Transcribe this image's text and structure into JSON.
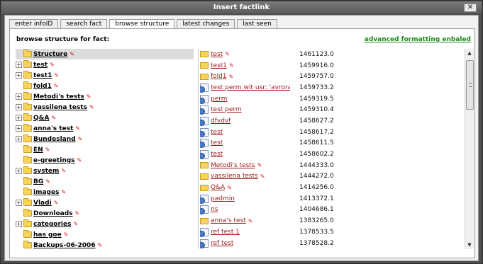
{
  "window": {
    "title": "Insert factlink",
    "close_icon": "✕"
  },
  "tabs": [
    {
      "label": "enter infoID"
    },
    {
      "label": "search fact"
    },
    {
      "label": "browse structure",
      "active": true
    },
    {
      "label": "latest changes"
    },
    {
      "label": "last seen"
    }
  ],
  "panel": {
    "header": "browse structure for fact:",
    "advanced_link": "advanced formatting enbaled"
  },
  "tree": [
    {
      "label": "Structure",
      "root": true,
      "expander": false,
      "pin": true
    },
    {
      "label": "test",
      "expander": true,
      "pin": true
    },
    {
      "label": "test1",
      "expander": true,
      "pin": true
    },
    {
      "label": "fold1",
      "expander": false,
      "pin": true
    },
    {
      "label": "Metodi's tests",
      "expander": true,
      "pin": true
    },
    {
      "label": "vassilena tests",
      "expander": true,
      "pin": true
    },
    {
      "label": "Q&A",
      "expander": true,
      "pin": true
    },
    {
      "label": "anna's test",
      "expander": true,
      "pin": true
    },
    {
      "label": "Bundesland",
      "expander": true,
      "pin": true
    },
    {
      "label": "EN",
      "expander": false,
      "pin": true
    },
    {
      "label": "e-greetings",
      "expander": false,
      "pin": true
    },
    {
      "label": "system",
      "expander": true,
      "pin": true
    },
    {
      "label": "BG",
      "expander": false,
      "pin": true
    },
    {
      "label": "images",
      "expander": false,
      "pin": true
    },
    {
      "label": "Vladi",
      "expander": true,
      "pin": true
    },
    {
      "label": "Downloads",
      "expander": false,
      "pin": true
    },
    {
      "label": "categories",
      "expander": true,
      "pin": true
    },
    {
      "label": "has goe",
      "expander": false,
      "pin": true
    },
    {
      "label": "Backups-06-2006",
      "expander": false,
      "pin": true
    }
  ],
  "list": [
    {
      "label": "test",
      "type": "folder",
      "id": "1461123.0",
      "pin": true
    },
    {
      "label": "test1",
      "type": "folder",
      "id": "1459916.0",
      "pin": true
    },
    {
      "label": "fold1",
      "type": "folder",
      "id": "1459757.0",
      "pin": true
    },
    {
      "label": "test perm wit usr: 'avrora_gea'",
      "type": "doc",
      "id": "1459733.2",
      "pin": false
    },
    {
      "label": "perm",
      "type": "doc",
      "id": "1459319.5",
      "pin": false
    },
    {
      "label": "test perm",
      "type": "doc",
      "id": "1459310.4",
      "pin": false
    },
    {
      "label": "dfvdvf",
      "type": "doc",
      "id": "1458627.2",
      "pin": false
    },
    {
      "label": "test",
      "type": "doc",
      "id": "1458617.2",
      "pin": false
    },
    {
      "label": "test",
      "type": "doc",
      "id": "1458611.5",
      "pin": false
    },
    {
      "label": "test",
      "type": "doc",
      "id": "1458602.2",
      "pin": false
    },
    {
      "label": "Metodi's tests",
      "type": "folder",
      "id": "1444333.0",
      "pin": true
    },
    {
      "label": "vassilena tests",
      "type": "folder",
      "id": "1444272.0",
      "pin": true
    },
    {
      "label": "Q&A",
      "type": "folder",
      "id": "1414256.0",
      "pin": true
    },
    {
      "label": "padmin",
      "type": "doc",
      "id": "1413372.1",
      "pin": false
    },
    {
      "label": "ns",
      "type": "doc",
      "id": "1404686.1",
      "pin": false
    },
    {
      "label": "anna's test",
      "type": "folder",
      "id": "1383265.0",
      "pin": true
    },
    {
      "label": "ref test 1",
      "type": "doc",
      "id": "1378533.5",
      "pin": false
    },
    {
      "label": "ref test",
      "type": "doc",
      "id": "1378528.2",
      "pin": false
    }
  ],
  "scrollbar": {
    "up_icon": "▲",
    "down_icon": "▼"
  },
  "colors": {
    "link_green": "#1a8a1a",
    "link_red": "#9a1a1a",
    "titlebar": "#6a6a6a"
  }
}
